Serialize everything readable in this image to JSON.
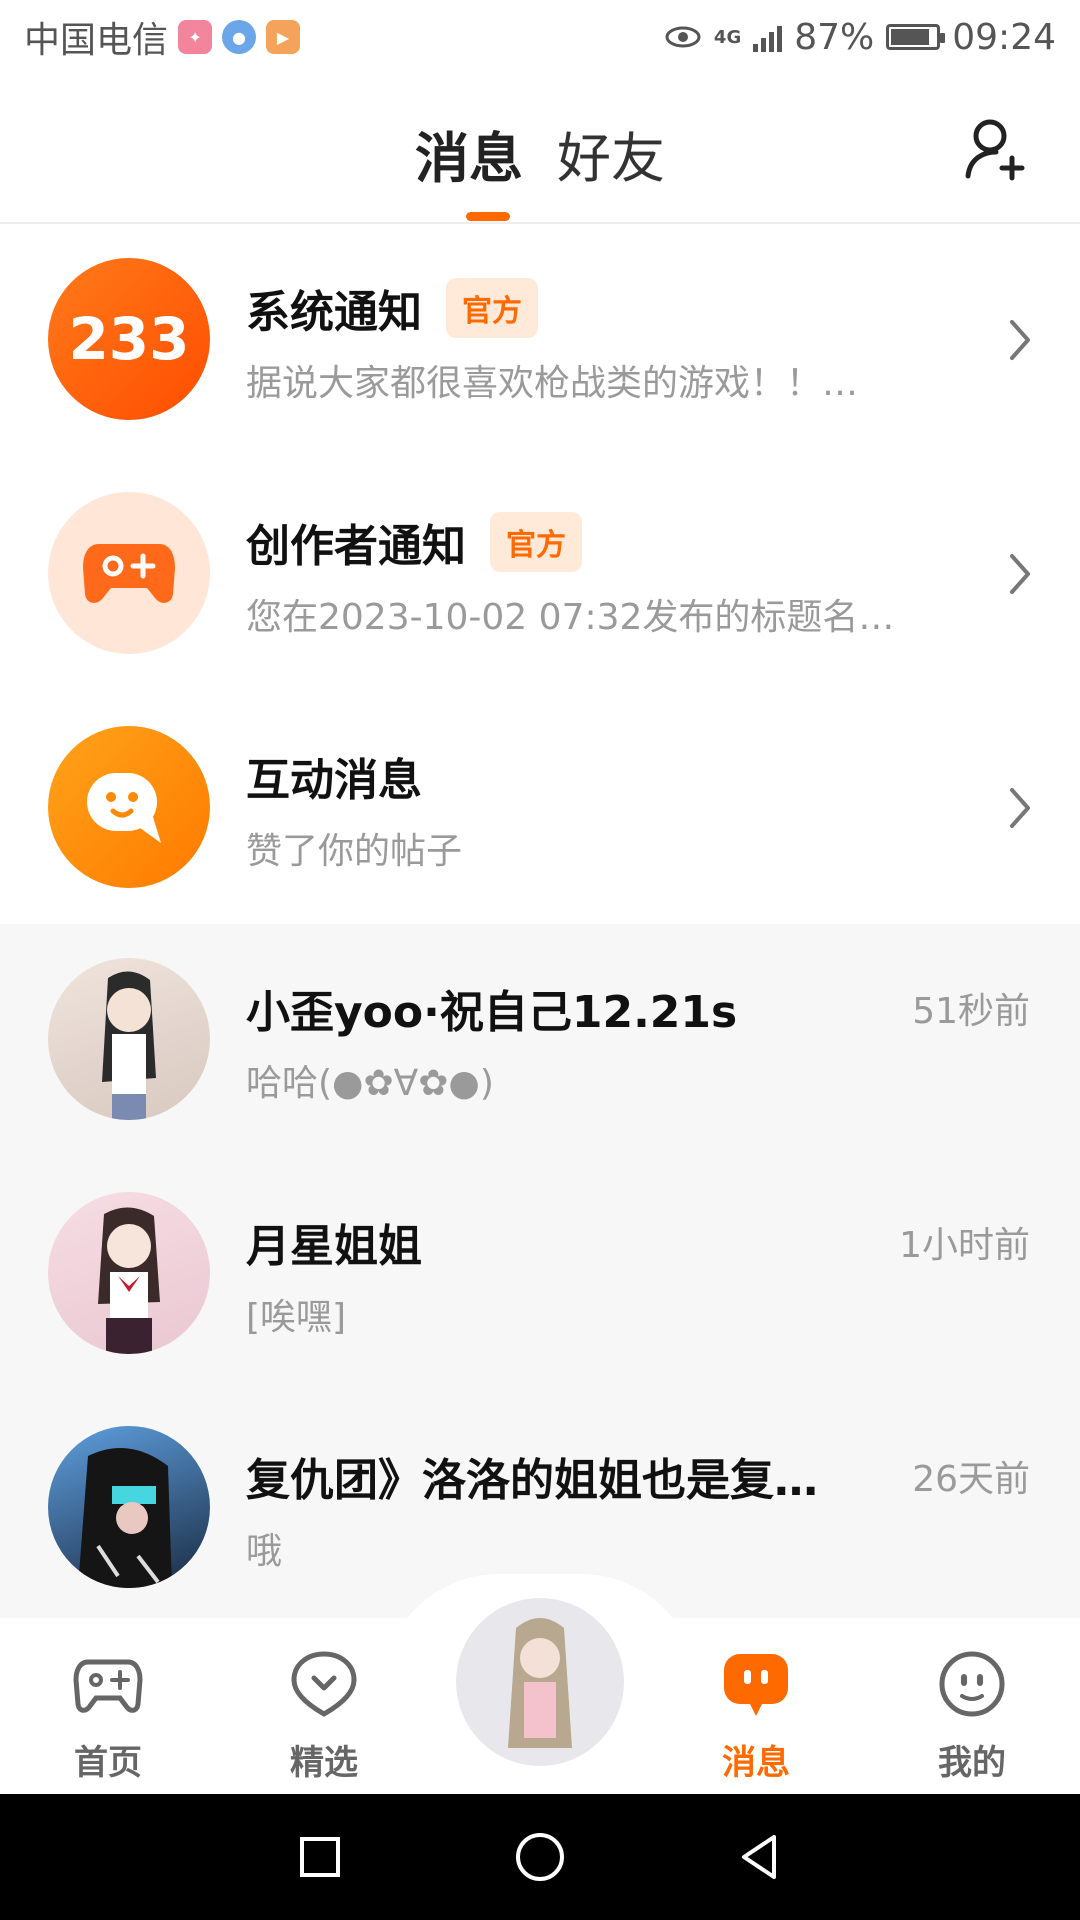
{
  "status_bar": {
    "carrier": "中国电信",
    "network": "4G",
    "battery": "87%",
    "battery_level": 0.87,
    "time": "09:24"
  },
  "header": {
    "tabs": [
      {
        "label": "消息",
        "active": true
      },
      {
        "label": "好友",
        "active": false
      }
    ],
    "add_friend_icon": "add-user-icon"
  },
  "official_items": [
    {
      "title": "系统通知",
      "badge": "官方",
      "subtitle": "据说大家都很喜欢枪战类的游戏！！…",
      "avatar_text": "233",
      "avatar_color": "#FF5A00"
    },
    {
      "title": "创作者通知",
      "badge": "官方",
      "subtitle": "您在2023-10-02 07:32发布的标题名…",
      "avatar_icon": "gamepad-plus-icon",
      "avatar_color": "#FFE6D6"
    },
    {
      "title": "互动消息",
      "badge": "",
      "subtitle": "赞了你的帖子",
      "avatar_icon": "chat-smile-icon",
      "avatar_color": "#FF8A00"
    }
  ],
  "chats": [
    {
      "name": "小歪yoo·祝自己12.21s",
      "preview": "哈哈(●✿∀✿●)",
      "time": "51秒前"
    },
    {
      "name": "月星姐姐",
      "preview": "[唉嘿]",
      "time": "1小时前"
    },
    {
      "name": "复仇团》洛洛的姐姐也是复…",
      "preview": "哦",
      "time": "26天前"
    }
  ],
  "bottom_nav": [
    {
      "label": "首页",
      "icon": "gamepad-icon",
      "active": false
    },
    {
      "label": "精选",
      "icon": "heart-chat-icon",
      "active": false
    },
    {
      "label": "",
      "icon": "center-avatar",
      "active": false
    },
    {
      "label": "消息",
      "icon": "message-icon",
      "active": true
    },
    {
      "label": "我的",
      "icon": "profile-face-icon",
      "active": false
    }
  ],
  "colors": {
    "accent": "#FF6A00",
    "badge_bg": "#FFE9D9",
    "muted_text": "#9a9a9a",
    "chat_bg": "#f7f7f7"
  }
}
